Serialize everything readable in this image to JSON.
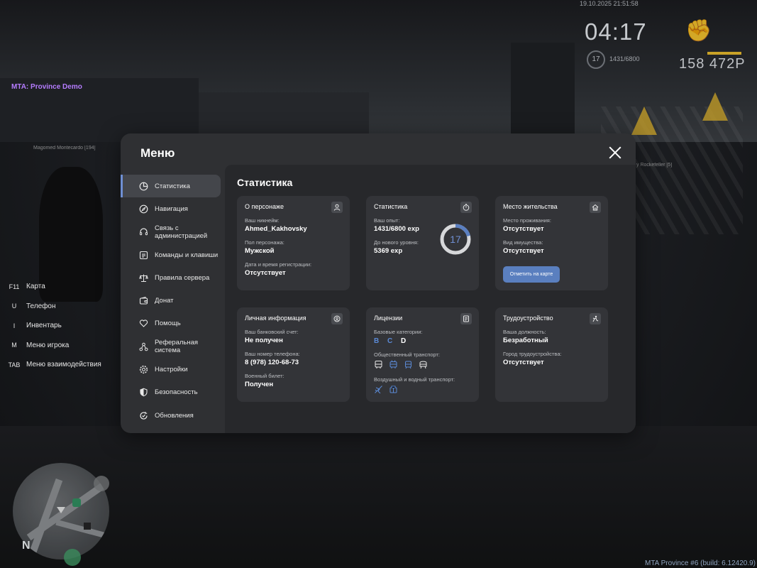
{
  "hud": {
    "datetime": "19.10.2025 21:51:58",
    "clock": "04:17",
    "level": "17",
    "exp": "1431/6800",
    "money": "158 472Р"
  },
  "server_tag": "MTA: Province Demo",
  "nametags": [
    "Magomed Montecardo [194]",
    "y Rockefeller [5]"
  ],
  "hotkeys": [
    {
      "key": "F11",
      "label": "Карта"
    },
    {
      "key": "U",
      "label": "Телефон"
    },
    {
      "key": "I",
      "label": "Инвентарь"
    },
    {
      "key": "M",
      "label": "Меню игрока"
    },
    {
      "key": "TAB",
      "label": "Меню взаимодействия"
    }
  ],
  "compass": "N",
  "build": "MTA Province #6 (build: 6.12420.9)",
  "menu": {
    "title": "Меню",
    "sidebar": [
      {
        "label": "Статистика",
        "icon": "pie-chart-icon"
      },
      {
        "label": "Навигация",
        "icon": "compass-icon"
      },
      {
        "label": "Связь с администрацией",
        "icon": "headset-icon"
      },
      {
        "label": "Команды и клавиши",
        "icon": "keyboard-icon"
      },
      {
        "label": "Правила сервера",
        "icon": "scales-icon"
      },
      {
        "label": "Донат",
        "icon": "wallet-icon"
      },
      {
        "label": "Помощь",
        "icon": "heart-hand-icon"
      },
      {
        "label": "Реферальная система",
        "icon": "referral-icon"
      },
      {
        "label": "Настройки",
        "icon": "gear-icon"
      },
      {
        "label": "Безопасность",
        "icon": "shield-icon"
      },
      {
        "label": "Обновления",
        "icon": "refresh-icon"
      }
    ],
    "active": "Статистика"
  },
  "stats": {
    "title": "Статистика",
    "character": {
      "title": "О персонаже",
      "nick_label": "Ваш никнейм:",
      "nick": "Ahmed_Kakhovsky",
      "gender_label": "Пол персонажа:",
      "gender": "Мужской",
      "reg_label": "Дата и время регистрации:",
      "reg": "Отсутствует"
    },
    "statistics": {
      "title": "Статистика",
      "exp_label": "Ваш опыт:",
      "exp": "1431/6800 exp",
      "next_label": "До нового уровня:",
      "next": "5369 exp",
      "level": "17",
      "progress": 0.21
    },
    "residence": {
      "title": "Место жительства",
      "place_label": "Место проживания:",
      "place": "Отсутствует",
      "property_label": "Вид имущества:",
      "property": "Отсутствует",
      "button": "Отметить на карте"
    },
    "personal": {
      "title": "Личная информация",
      "bank_label": "Ваш банковский счет:",
      "bank": "Не получен",
      "phone_label": "Ваш номер телефона:",
      "phone": "8 (978) 120-68-73",
      "military_label": "Военный билет:",
      "military": "Получен"
    },
    "licenses": {
      "title": "Лицензии",
      "base_label": "Базовые категории:",
      "categories": [
        {
          "letter": "B",
          "color": "#5b8ad6"
        },
        {
          "letter": "C",
          "color": "#5b8ad6"
        },
        {
          "letter": "D",
          "color": "#ffffff"
        }
      ],
      "public_label": "Общественный транспорт:",
      "air_label": "Воздушный и водный транспорт:"
    },
    "employment": {
      "title": "Трудоустройство",
      "position_label": "Ваша должность:",
      "position": "Безработный",
      "city_label": "Город трудоустройства:",
      "city": "Отсутствует"
    }
  }
}
